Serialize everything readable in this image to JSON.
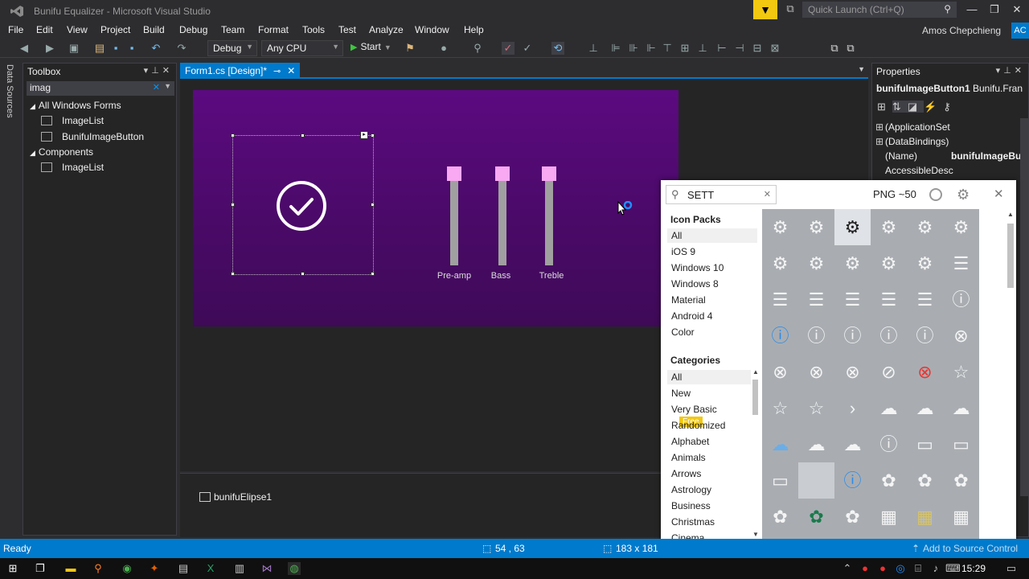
{
  "window": {
    "title": "Bunifu Equalizer - Microsoft Visual Studio",
    "quick_launch_placeholder": "Quick Launch (Ctrl+Q)"
  },
  "menu": {
    "items": [
      "File",
      "Edit",
      "View",
      "Project",
      "Build",
      "Debug",
      "Team",
      "Format",
      "Tools",
      "Test",
      "Analyze",
      "Window",
      "Help"
    ],
    "user": "Amos Chepchieng",
    "avatar": "AC"
  },
  "toolbar": {
    "configuration": "Debug",
    "platform": "Any CPU",
    "start_label": "Start"
  },
  "side_tab": {
    "label": "Data Sources"
  },
  "toolbox": {
    "title": "Toolbox",
    "search_value": "imag",
    "groups": [
      {
        "label": "All Windows Forms",
        "items": [
          "ImageList",
          "BunifuImageButton"
        ]
      },
      {
        "label": "Components",
        "items": [
          "ImageList"
        ]
      }
    ]
  },
  "document": {
    "tab_label": "Form1.cs [Design]*"
  },
  "designer": {
    "slider_labels": [
      "Pre-amp",
      "Bass",
      "Treble"
    ],
    "tray_component": "bunifuElipse1"
  },
  "properties": {
    "title": "Properties",
    "object_name": "bunifuImageButton1",
    "object_type": "Bunifu.Fran",
    "rows": [
      {
        "expand": "⊞",
        "name": "(ApplicationSet",
        "value": ""
      },
      {
        "expand": "⊞",
        "name": "(DataBindings)",
        "value": ""
      },
      {
        "expand": "",
        "name": "(Name)",
        "value": "bunifuImageBu"
      },
      {
        "expand": "",
        "name": "AccessibleDesc",
        "value": ""
      }
    ]
  },
  "icon_picker": {
    "search_value": "SETT",
    "format_label": "PNG ~50",
    "icon_packs_heading": "Icon Packs",
    "icon_packs": [
      "All",
      "iOS 9",
      "Windows 10",
      "Windows 8",
      "Material",
      "Android 4",
      "Color"
    ],
    "categories_heading": "Categories",
    "categories": [
      "All",
      "New",
      "Very Basic",
      "Randomized",
      "Alphabet",
      "Animals",
      "Arrows",
      "Astrology",
      "Business",
      "Christmas",
      "Cinema"
    ],
    "free_badge": "Free",
    "icons": [
      "gear",
      "gear",
      "gear",
      "gear",
      "gear",
      "gear",
      "gears",
      "gears",
      "gears",
      "gears",
      "gears",
      "menu",
      "menu",
      "menu",
      "menu",
      "menu",
      "menu",
      "info",
      "info",
      "info",
      "info",
      "info",
      "info",
      "close",
      "close",
      "close",
      "close",
      "no",
      "close",
      "star",
      "star",
      "star",
      "chevron",
      "cloud",
      "cloud",
      "cloud",
      "cloud",
      "cloud",
      "cloud",
      "info",
      "comment",
      "comment",
      "comment",
      "blank",
      "info",
      "plant",
      "plant",
      "plant",
      "plant",
      "plant",
      "plant",
      "film",
      "film",
      "film"
    ]
  },
  "status": {
    "text": "Ready",
    "position": "54 , 63",
    "size": "183 x 181",
    "source_control": "Add to Source Control"
  },
  "clock": "15:29",
  "colors": {
    "accent": "#007acc",
    "form_gradient_top": "#5c0a80",
    "slider_thumb": "#f9a8f2"
  }
}
